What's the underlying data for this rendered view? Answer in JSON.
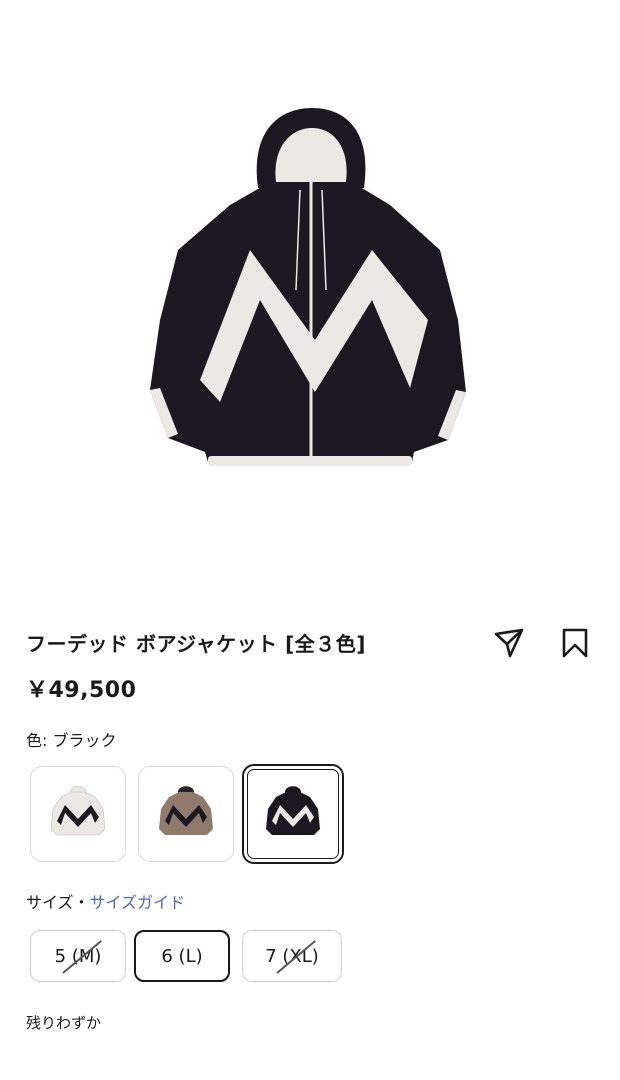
{
  "product": {
    "image_icon": "product-photo-hooded-jacket",
    "title": "フーデッド ボアジャケット [全３色]",
    "price": "￥49,500"
  },
  "actions": {
    "share_icon": "send-icon",
    "bookmark_icon": "bookmark-icon"
  },
  "color": {
    "label": "色: ブラック",
    "options": [
      {
        "name": "white",
        "body": "#ece9e4",
        "stripe": "#1b1822",
        "selected": false
      },
      {
        "name": "brown",
        "body": "#8f7a6c",
        "stripe": "#1b1822",
        "selected": false
      },
      {
        "name": "black",
        "body": "#1b1822",
        "stripe": "#ece9e4",
        "selected": true
      }
    ]
  },
  "size": {
    "label": "サイズ・",
    "guide_link": "サイズガイド",
    "options": [
      {
        "label": "5 (M)",
        "available": false,
        "selected": false
      },
      {
        "label": "6 (L)",
        "available": true,
        "selected": true
      },
      {
        "label": "7 (XL)",
        "available": false,
        "selected": false
      }
    ]
  },
  "stock_status": "残りわずか",
  "colors": {
    "link": "#4a67c9",
    "text": "#1a1a1a",
    "jacket_black": "#1b1822",
    "jacket_cream": "#ece9e4"
  }
}
